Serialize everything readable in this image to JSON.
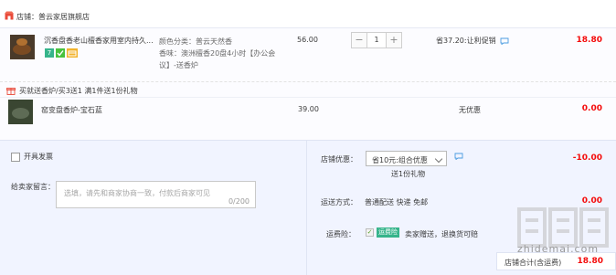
{
  "shop": {
    "label": "店铺：普云家居旗舰店"
  },
  "item1": {
    "title": "沉香盘香老山檀香家用室内持久...",
    "badges": [
      "7"
    ],
    "attr_color": "颜色分类：普云天然香",
    "attr_scent": "香味：澳洲檀香20盘4小时【办公会议】-送香炉",
    "unit_price": "56.00",
    "quantity": "1",
    "discount": "省37.20:让利促销",
    "subtotal": "18.80"
  },
  "promo": {
    "text": "买就送香炉/买3送1    满1件送1份礼物"
  },
  "item2": {
    "title": "窑变盘香炉-宝石蓝",
    "unit_price": "39.00",
    "discount": "无优惠",
    "subtotal": "0.00"
  },
  "order": {
    "invoice_label": "开具发票",
    "message_label": "给卖家留言：",
    "message_placeholder": "选填，请先和商家协商一致，付款后商家可见",
    "message_count": "0/200",
    "shop_promo_label": "店铺优惠：",
    "shop_promo_value": "省10元:组合优惠",
    "gift_note": "送1份礼物",
    "shop_promo_amount": "-10.00",
    "shipping_label": "运送方式：",
    "shipping_value": "普通配送 快递 免邮",
    "shipping_fee": "0.00",
    "insurance_label": "运费险：",
    "insurance_badge": "运费险",
    "insurance_text": "卖家赠送，退换货可赔",
    "total_label": "店铺合计(含运费)",
    "total_amount": "18.80"
  },
  "watermark": {
    "text": "zhidemai.com"
  },
  "colors": {
    "accent_red": "#f40b0b",
    "panel_bg": "#f1f4ff",
    "green": "#36b48b"
  }
}
